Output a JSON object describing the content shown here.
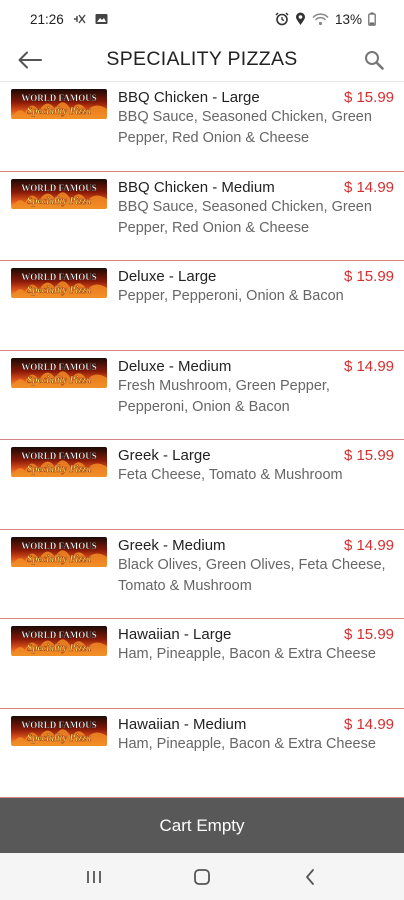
{
  "status_bar": {
    "time": "21:26",
    "battery_percent": "13%",
    "icons": [
      "mute-icon",
      "photo-icon",
      "alarm-icon",
      "location-icon",
      "wifi-icon",
      "battery-icon"
    ]
  },
  "header": {
    "title": "SPECIALITY PIZZAS",
    "back_icon": "arrow-left-icon",
    "search_icon": "search-icon"
  },
  "thumb_logo": {
    "line1": "WORLD FAMOUS",
    "line2": "Speciality Pizza"
  },
  "colors": {
    "price": "#d32f2f",
    "divider": "#d98585",
    "cart_bar": "#585858"
  },
  "menu_items": [
    {
      "name": "BBQ Chicken - Large",
      "price": "$ 15.99",
      "description": "BBQ Sauce, Seasoned Chicken, Green Pepper, Red Onion & Cheese"
    },
    {
      "name": "BBQ Chicken - Medium",
      "price": "$ 14.99",
      "description": "BBQ Sauce, Seasoned Chicken, Green Pepper, Red Onion & Cheese"
    },
    {
      "name": "Deluxe - Large",
      "price": "$ 15.99",
      "description": "Pepper, Pepperoni, Onion & Bacon"
    },
    {
      "name": "Deluxe - Medium",
      "price": "$ 14.99",
      "description": "Fresh Mushroom, Green Pepper, Pepperoni, Onion & Bacon"
    },
    {
      "name": "Greek - Large",
      "price": "$ 15.99",
      "description": "Feta Cheese, Tomato & Mushroom"
    },
    {
      "name": "Greek - Medium",
      "price": "$ 14.99",
      "description": "Black Olives, Green Olives, Feta Cheese, Tomato & Mushroom"
    },
    {
      "name": "Hawaiian - Large",
      "price": "$ 15.99",
      "description": "Ham, Pineapple, Bacon & Extra Cheese"
    },
    {
      "name": "Hawaiian - Medium",
      "price": "$ 14.99",
      "description": "Ham, Pineapple, Bacon & Extra Cheese"
    }
  ],
  "cart": {
    "label": "Cart Empty"
  },
  "nav_bar": {
    "icons": [
      "recent-apps-icon",
      "home-icon",
      "back-nav-icon"
    ]
  }
}
